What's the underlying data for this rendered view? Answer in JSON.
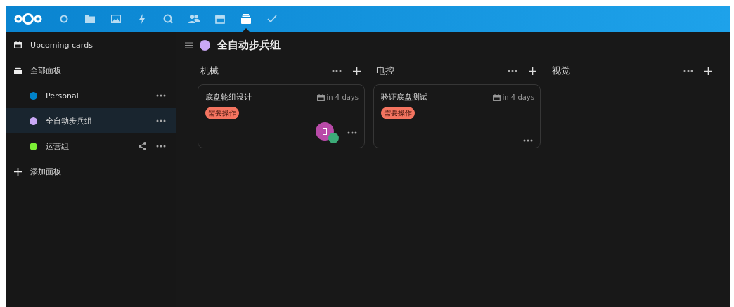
{
  "header": {
    "apps": [
      {
        "kind": "circle",
        "selected": false
      },
      {
        "kind": "folder",
        "selected": false
      },
      {
        "kind": "image",
        "selected": false
      },
      {
        "kind": "bolt",
        "selected": false
      },
      {
        "kind": "search",
        "selected": false
      },
      {
        "kind": "contacts",
        "selected": false
      },
      {
        "kind": "calendar",
        "selected": false
      },
      {
        "kind": "deck",
        "selected": true
      },
      {
        "kind": "check",
        "selected": false
      }
    ]
  },
  "sidebar": {
    "items": [
      {
        "kind": "upcoming",
        "label": "Upcoming cards",
        "selected": false
      },
      {
        "kind": "all",
        "label": "全部面板",
        "selected": false,
        "children": [
          {
            "label": "Personal",
            "color": "#0082c9",
            "shared": false,
            "selected": false
          },
          {
            "label": "全自动步兵组",
            "color": "#c9a8f5",
            "shared": false,
            "selected": true
          },
          {
            "label": "运营组",
            "color": "#7cf035",
            "shared": true,
            "selected": false
          }
        ]
      },
      {
        "kind": "add",
        "label": "添加面板",
        "selected": false
      }
    ]
  },
  "board": {
    "title": "全自动步兵组",
    "color": "#c9a8f5",
    "stacks": [
      {
        "title": "机械",
        "cards": [
          {
            "title": "底盘轮组设计",
            "due": "in 4 days",
            "labels": [
              {
                "text": "需要操作",
                "color": "#f47460"
              }
            ],
            "assigned": true
          }
        ]
      },
      {
        "title": "电控",
        "cards": [
          {
            "title": "验证底盘测试",
            "due": "in 4 days",
            "labels": [
              {
                "text": "需要操作",
                "color": "#f47460"
              }
            ],
            "assigned": false
          }
        ]
      },
      {
        "title": "视觉"
      }
    ]
  }
}
